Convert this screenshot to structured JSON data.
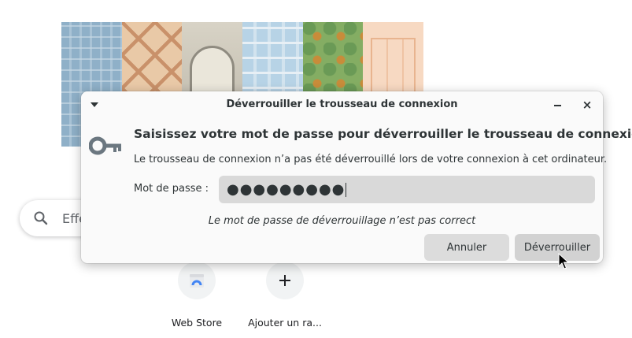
{
  "background": {
    "search": {
      "text": "Effe",
      "icon": "search-icon"
    },
    "shortcuts": [
      {
        "label": "Web Store",
        "icon": "web-store-icon"
      },
      {
        "label": "Ajouter un ra...",
        "icon": "plus-icon"
      }
    ]
  },
  "dialog": {
    "title": "Déverrouiller le trousseau de connexion",
    "heading": "Saisissez votre mot de passe pour déverrouiller le trousseau de connexion",
    "description": "Le trousseau de connexion n’a pas été déverrouillé lors de votre connexion à cet ordinateur.",
    "password_label": "Mot de passe :",
    "password_value": "●●●●●●●●●",
    "error": "Le mot de passe de déverrouillage n’est pas correct",
    "cancel_label": "Annuler",
    "unlock_label": "Déverrouiller",
    "minimize_glyph": "–",
    "close_glyph": "×"
  },
  "colors": {
    "dialog_bg": "#fafafa",
    "button_bg": "#dcdcdc",
    "text": "#2e3436",
    "field_bg": "#d9d9d9"
  }
}
